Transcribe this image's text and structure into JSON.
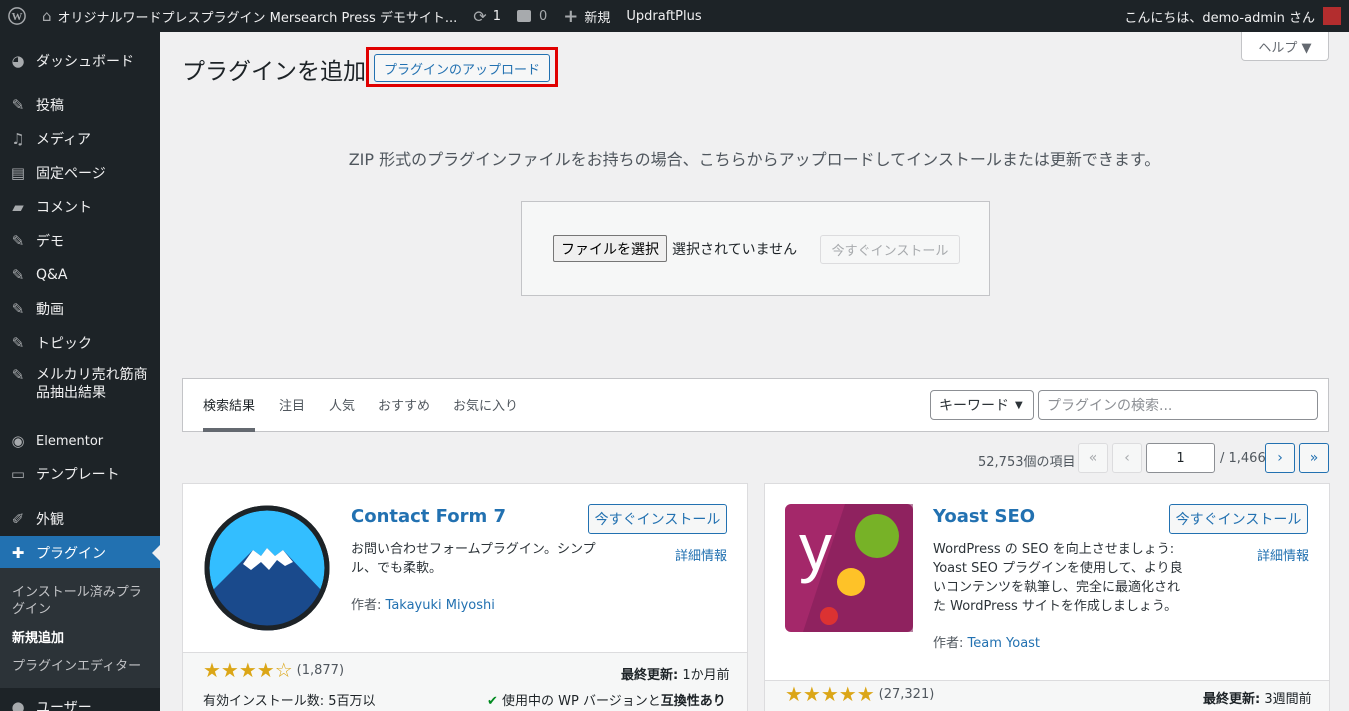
{
  "adminbar": {
    "site_title": "オリジナルワードプレスプラグイン Mersearch Press デモサイト...",
    "updates_count": "1",
    "comments_count": "0",
    "new_label": "新規",
    "updraft_label": "UpdraftPlus",
    "greeting": "こんにちは、demo-admin さん"
  },
  "sidebar": {
    "items": [
      {
        "label": "ダッシュボード",
        "icon": "dashboard-icon"
      },
      {
        "label": "投稿",
        "icon": "pin-icon"
      },
      {
        "label": "メディア",
        "icon": "media-icon"
      },
      {
        "label": "固定ページ",
        "icon": "page-icon"
      },
      {
        "label": "コメント",
        "icon": "comment-icon"
      },
      {
        "label": "デモ",
        "icon": "pin-icon"
      },
      {
        "label": "Q&A",
        "icon": "pin-icon"
      },
      {
        "label": "動画",
        "icon": "pin-icon"
      },
      {
        "label": "トピック",
        "icon": "pin-icon"
      },
      {
        "label": "メルカリ売れ筋商品抽出結果",
        "icon": "pin-icon"
      },
      {
        "label": "Elementor",
        "icon": "elementor-icon"
      },
      {
        "label": "テンプレート",
        "icon": "folder-icon"
      },
      {
        "label": "外観",
        "icon": "brush-icon"
      },
      {
        "label": "プラグイン",
        "icon": "plugin-icon"
      },
      {
        "label": "ユーザー",
        "icon": "user-icon"
      }
    ],
    "submenu": [
      {
        "label": "インストール済みプラグイン"
      },
      {
        "label": "新規追加"
      },
      {
        "label": "プラグインエディター"
      }
    ]
  },
  "page": {
    "title": "プラグインを追加",
    "upload_button": "プラグインのアップロード",
    "help_label": "ヘルプ ▼"
  },
  "upload": {
    "description": "ZIP 形式のプラグインファイルをお持ちの場合、こちらからアップロードしてインストールまたは更新できます。",
    "file_button": "ファイルを選択",
    "file_status": "選択されていません",
    "install_button": "今すぐインストール"
  },
  "filters": {
    "tabs": [
      "検索結果",
      "注目",
      "人気",
      "おすすめ",
      "お気に入り"
    ],
    "keyword_select": "キーワード",
    "search_placeholder": "プラグインの検索..."
  },
  "pagination": {
    "count": "52,753個の項目",
    "current_page": "1",
    "total": "/ 1,466",
    "first": "«",
    "prev": "‹",
    "next": "›",
    "last": "»"
  },
  "plugins": [
    {
      "name": "Contact Form 7",
      "description": "お問い合わせフォームプラグイン。シンプル、でも柔軟。",
      "author_label": "作者:",
      "author": "Takayuki Miyoshi",
      "install": "今すぐインストール",
      "more": "詳細情報",
      "rating": 4,
      "stars": "★★★★☆",
      "rating_count": "(1,877)",
      "last_updated_label": "最終更新:",
      "last_updated": "1か月前",
      "active_installs": "有効インストール数: 5百万以",
      "compat_text": "使用中の WP バージョンと",
      "compat_bold": "互換性あり"
    },
    {
      "name": "Yoast SEO",
      "description": "WordPress の SEO を向上させましょう: Yoast SEO プラグインを使用して、より良いコンテンツを執筆し、完全に最適化された WordPress サイトを作成しましょう。",
      "author_label": "作者:",
      "author": "Team Yoast",
      "install": "今すぐインストール",
      "more": "詳細情報",
      "rating": 5,
      "stars": "★★★★★",
      "rating_count": "(27,321)",
      "last_updated_label": "最終更新:",
      "last_updated": "3週間前"
    }
  ],
  "colors": {
    "adminbar_bg": "#1d2327",
    "accent": "#2271b1",
    "highlight_box": "#e00000",
    "star": "#dba617"
  }
}
